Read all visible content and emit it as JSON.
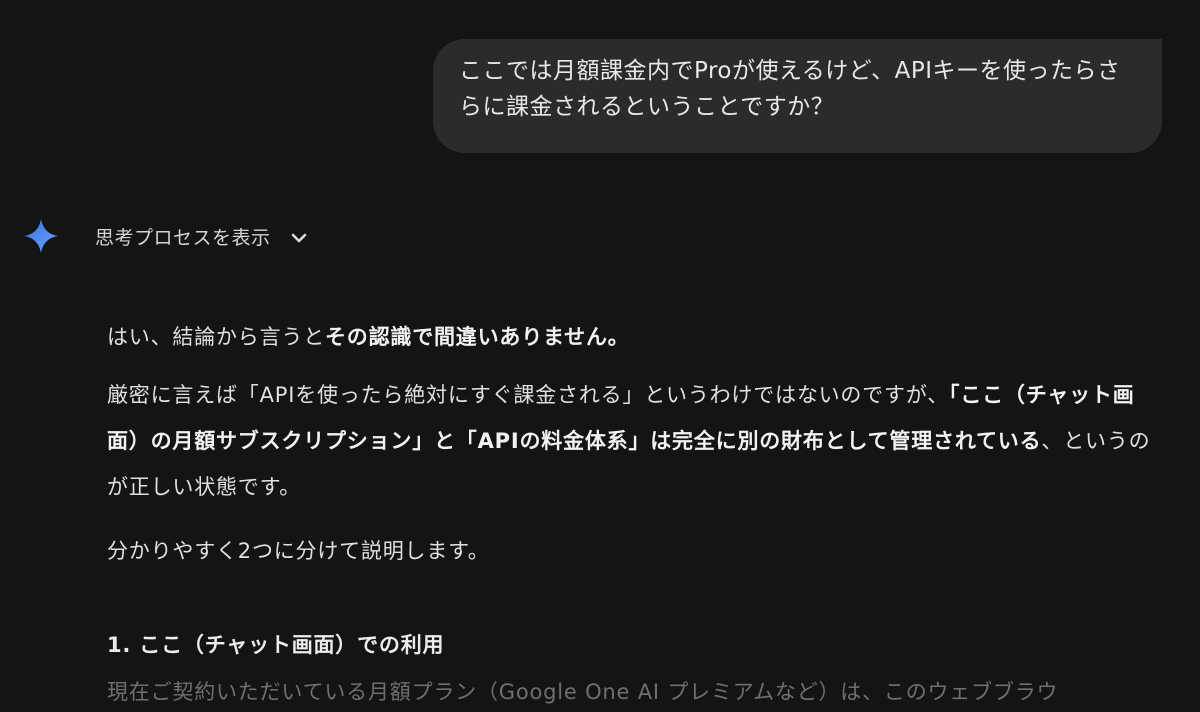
{
  "user_message": {
    "text": "ここでは月額課金内でProが使えるけど、APIキーを使ったらさらに課金されるということですか？"
  },
  "thinking": {
    "label": "思考プロセスを表示",
    "icon": "chevron-down-icon",
    "accent_color": "#4f8df7"
  },
  "response": {
    "p1": {
      "plain": "はい、結論から言うと",
      "bold": "その認識で間違いありません。"
    },
    "p2": {
      "plain_1": "厳密に言えば「APIを使ったら絶対にすぐ課金される」というわけではないのですが、",
      "bold": "「ここ（チャット画面）の月額サブスクリプション」と「APIの料金体系」は完全に別の財布として管理されている",
      "plain_2": "、というのが正しい状態です。"
    },
    "p3": "分かりやすく2つに分けて説明します。",
    "heading_1": "1. ここ（チャット画面）での利用",
    "p4": "現在ご契約いただいている月額プラン（Google One AI プレミアムなど）は、このウェブブラウ"
  }
}
